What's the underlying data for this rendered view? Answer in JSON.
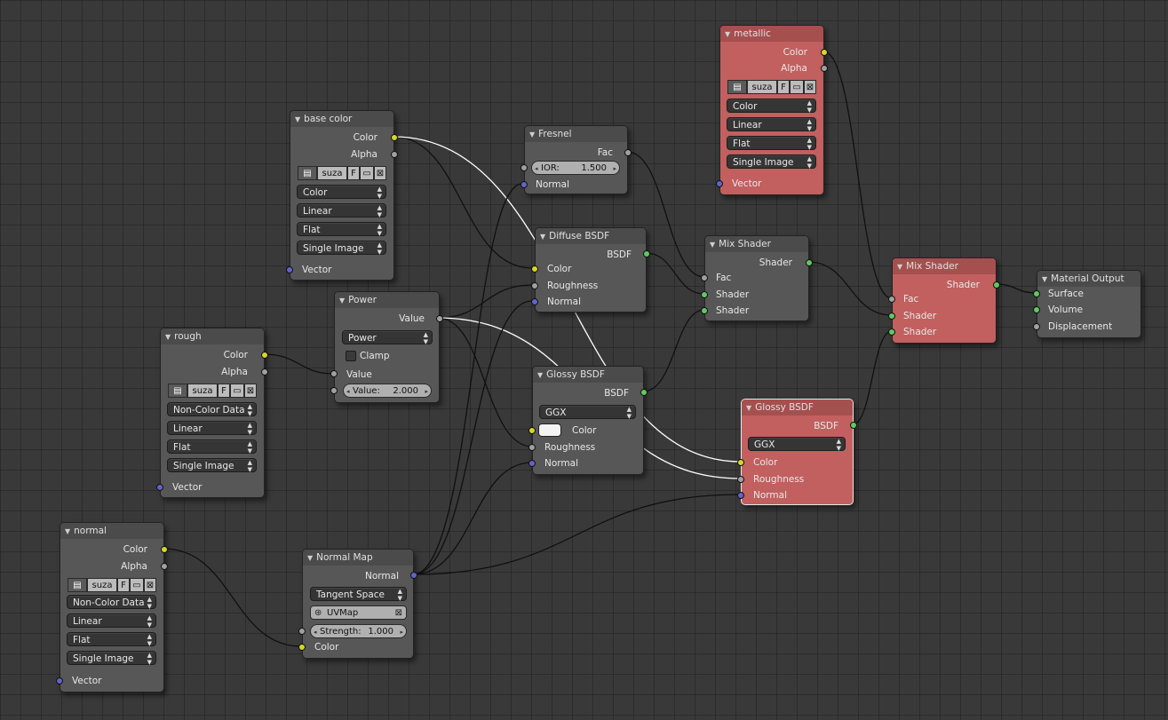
{
  "colors": {
    "yellow_socket": "#d6d628",
    "grey_socket": "#a0a0a0",
    "blue_socket": "#6363c7",
    "green_socket": "#5fc95f",
    "node_bg": "#575757",
    "node_red": "#c25f5f"
  },
  "image_node_common": {
    "image_name": "suza",
    "fake_user": "F",
    "open_icon": "folder-icon",
    "close_icon": "x-icon"
  },
  "nodes": {
    "base_color": {
      "title": "base color",
      "out_color": "Color",
      "out_alpha": "Alpha",
      "color_space": "Color",
      "interpolation": "Linear",
      "projection": "Flat",
      "source": "Single Image",
      "in_vector": "Vector"
    },
    "rough": {
      "title": "rough",
      "out_color": "Color",
      "out_alpha": "Alpha",
      "color_space": "Non-Color Data",
      "interpolation": "Linear",
      "projection": "Flat",
      "source": "Single Image",
      "in_vector": "Vector"
    },
    "normal": {
      "title": "normal",
      "out_color": "Color",
      "out_alpha": "Alpha",
      "color_space": "Non-Color Data",
      "interpolation": "Linear",
      "projection": "Flat",
      "source": "Single Image",
      "in_vector": "Vector"
    },
    "metallic": {
      "title": "metallic",
      "out_color": "Color",
      "out_alpha": "Alpha",
      "color_space": "Color",
      "interpolation": "Linear",
      "projection": "Flat",
      "source": "Single Image",
      "in_vector": "Vector"
    },
    "power": {
      "title": "Power",
      "out_value": "Value",
      "operation": "Power",
      "clamp": "Clamp",
      "in_value": "Value",
      "value_label": "Value:",
      "value": "2.000"
    },
    "fresnel": {
      "title": "Fresnel",
      "out_fac": "Fac",
      "ior_label": "IOR:",
      "ior": "1.500",
      "in_normal": "Normal"
    },
    "diffuse": {
      "title": "Diffuse BSDF",
      "out_bsdf": "BSDF",
      "in_color": "Color",
      "in_roughness": "Roughness",
      "in_normal": "Normal"
    },
    "glossy1": {
      "title": "Glossy BSDF",
      "out_bsdf": "BSDF",
      "distribution": "GGX",
      "in_color": "Color",
      "in_roughness": "Roughness",
      "in_normal": "Normal"
    },
    "glossy2": {
      "title": "Glossy BSDF",
      "out_bsdf": "BSDF",
      "distribution": "GGX",
      "in_color": "Color",
      "in_roughness": "Roughness",
      "in_normal": "Normal"
    },
    "mix1": {
      "title": "Mix Shader",
      "out_shader": "Shader",
      "in_fac": "Fac",
      "in_shader1": "Shader",
      "in_shader2": "Shader"
    },
    "mix2": {
      "title": "Mix Shader",
      "out_shader": "Shader",
      "in_fac": "Fac",
      "in_shader1": "Shader",
      "in_shader2": "Shader"
    },
    "normal_map": {
      "title": "Normal Map",
      "out_normal": "Normal",
      "space": "Tangent Space",
      "uv_map": "UVMap",
      "strength_label": "Strength:",
      "strength": "1.000",
      "in_color": "Color"
    },
    "output": {
      "title": "Material Output",
      "in_surface": "Surface",
      "in_volume": "Volume",
      "in_displacement": "Displacement"
    }
  }
}
